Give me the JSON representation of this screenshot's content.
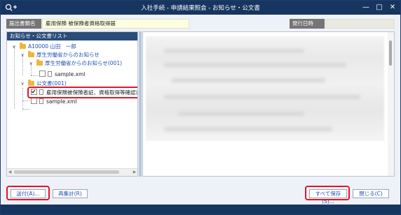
{
  "window": {
    "title": "入社手続 - 申請結果照会 - お知らせ・公文書",
    "controls": [
      "minimize-icon",
      "maximize-icon",
      "close-icon"
    ]
  },
  "info": {
    "output_name_label": "届出書類名",
    "output_name_value": "雇用保険 被保険者資格取得届",
    "issue_date_label": "発行日時",
    "issue_date_value": ""
  },
  "tree_panel": {
    "header": "お知らせ・公文書リスト",
    "nodes": {
      "root": "A10000 山田　一郎",
      "notices": "厚生労働省からのお知らせ",
      "notice_001": "厚生労働省からのお知らせ(001)",
      "notice_file": "sample.xml",
      "docs": "公文書(001)",
      "doc_cert": "雇用保険被保険者証、資格取得等確認通知",
      "doc_file": "sample.xml"
    }
  },
  "buttons": {
    "send": "送付(A)...",
    "recalc": "再集計(R)",
    "save_all": "すべて保存(S)...",
    "close": "閉じる(C)"
  },
  "colors": {
    "titlebar": "#17365f",
    "highlight": "#e0162b",
    "panel_header": "#2a4c78",
    "folder": "#f1b53c"
  }
}
